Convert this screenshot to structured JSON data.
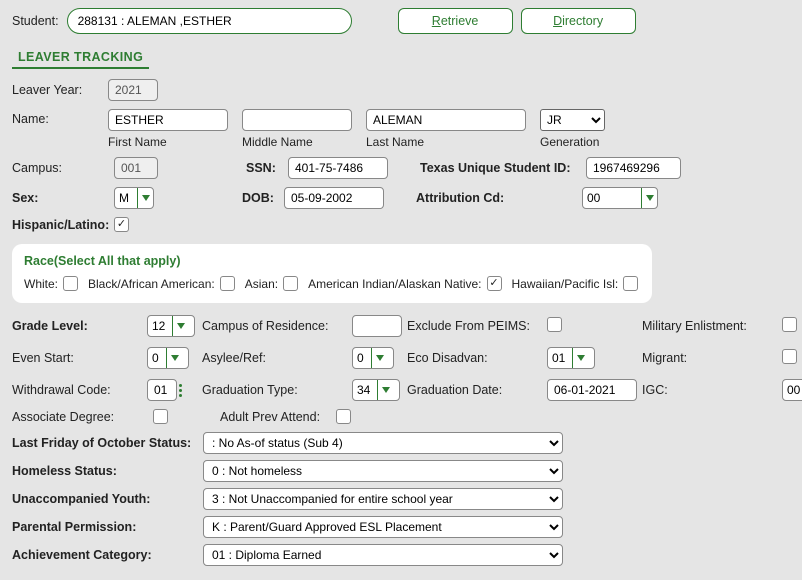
{
  "header": {
    "student_label": "Student:",
    "student_value": "288131 : ALEMAN ,ESTHER",
    "retrieve": "Retrieve",
    "directory": "Directory"
  },
  "tab": "LEAVER TRACKING",
  "labels": {
    "leaver_year": "Leaver Year:",
    "name": "Name:",
    "first_name": "First Name",
    "middle_name": "Middle Name",
    "last_name": "Last Name",
    "generation": "Generation",
    "campus": "Campus:",
    "ssn": "SSN:",
    "tx_id": "Texas Unique Student ID:",
    "sex": "Sex:",
    "dob": "DOB:",
    "attr_cd": "Attribution Cd:",
    "hispanic": "Hispanic/Latino:",
    "race_title": "Race(Select All that apply)",
    "white": "White:",
    "black": "Black/African American:",
    "asian": "Asian:",
    "native": "American Indian/Alaskan Native:",
    "pacific": "Hawaiian/Pacific Isl:",
    "grade_level": "Grade Level:",
    "campus_res": "Campus of Residence:",
    "exclude_peims": "Exclude From PEIMS:",
    "mil_enlist": "Military Enlistment:",
    "even_start": "Even Start:",
    "asylee": "Asylee/Ref:",
    "eco": "Eco Disadvan:",
    "migrant": "Migrant:",
    "withdrawal": "Withdrawal Code:",
    "grad_type": "Graduation Type:",
    "grad_date": "Graduation Date:",
    "igc": "IGC:",
    "assoc_deg": "Associate Degree:",
    "adult_prev": "Adult Prev Attend:",
    "last_friday": "Last Friday of October Status:",
    "homeless": "Homeless Status:",
    "unacc_youth": "Unaccompanied Youth:",
    "parental": "Parental Permission:",
    "achievement": "Achievement Category:"
  },
  "values": {
    "leaver_year": "2021",
    "first_name": "ESTHER",
    "middle_name": "",
    "last_name": "ALEMAN",
    "generation": "JR",
    "campus": "001",
    "ssn": "401-75-7486",
    "tx_id": "1967469296",
    "sex": "M",
    "dob": "05-09-2002",
    "attr_cd": "00",
    "hispanic_checked": "✓",
    "native_checked": "✓",
    "grade_level": "12",
    "campus_res": "",
    "even_start": "0",
    "asylee": "0",
    "eco": "01",
    "withdrawal": "01",
    "grad_type": "34",
    "grad_date": "06-01-2021",
    "igc": "00",
    "last_friday": ": No As-of status (Sub 4)",
    "homeless": "0 : Not homeless",
    "unacc_youth": "3 : Not Unaccompanied for entire school year",
    "parental": "K : Parent/Guard Approved ESL Placement",
    "achievement": "01 : Diploma Earned"
  }
}
